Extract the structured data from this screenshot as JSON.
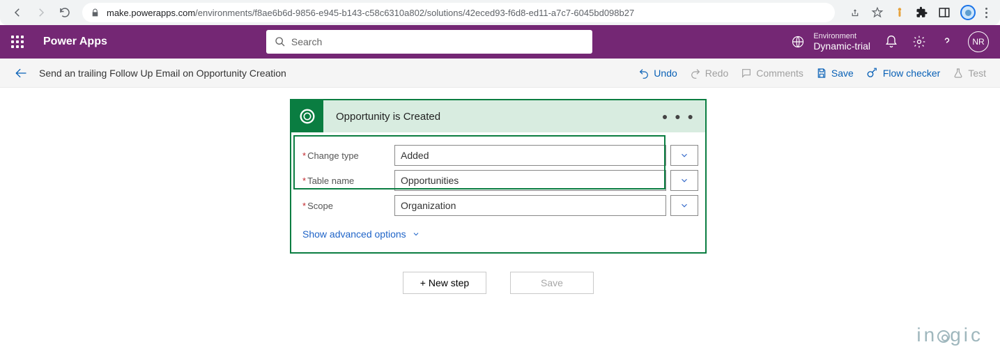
{
  "browser": {
    "url_host": "make.powerapps.com",
    "url_path": "/environments/f8ae6b6d-9856-e945-b143-c58c6310a802/solutions/42eced93-f6d8-ed11-a7c7-6045bd098b27"
  },
  "pa": {
    "title": "Power Apps",
    "search_placeholder": "Search",
    "env_label": "Environment",
    "env_value": "Dynamic-trial",
    "avatar_initials": "NR"
  },
  "sub": {
    "flow_title": "Send an trailing Follow Up Email on Opportunity Creation",
    "undo": "Undo",
    "redo": "Redo",
    "comments": "Comments",
    "save": "Save",
    "flow_checker": "Flow checker",
    "test": "Test"
  },
  "step": {
    "title": "Opportunity is Created",
    "fields": {
      "change_type": {
        "label": "Change type",
        "value": "Added"
      },
      "table_name": {
        "label": "Table name",
        "value": "Opportunities"
      },
      "scope": {
        "label": "Scope",
        "value": "Organization"
      }
    },
    "advanced": "Show advanced options"
  },
  "bottom": {
    "new_step": "+ New step",
    "save": "Save"
  },
  "watermark": "inogic"
}
